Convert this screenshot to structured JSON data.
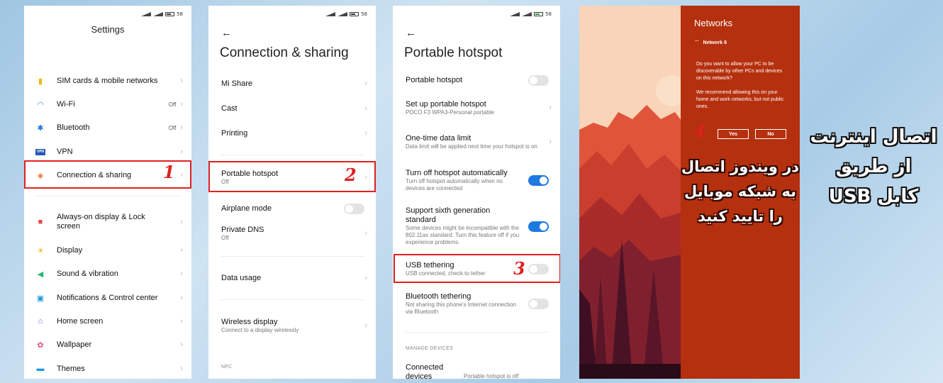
{
  "status": {
    "battery": "58"
  },
  "phone1": {
    "title": "Settings",
    "items": [
      {
        "icon": "sim-card-icon",
        "glyph": "▮",
        "color": "#f2b400",
        "label": "SIM cards & mobile networks",
        "value": ""
      },
      {
        "icon": "wifi-icon",
        "glyph": "◠",
        "color": "#1f9bde",
        "label": "Wi-Fi",
        "value": "Off"
      },
      {
        "icon": "bluetooth-icon",
        "glyph": "✱",
        "color": "#1f7ae0",
        "label": "Bluetooth",
        "value": "Off"
      },
      {
        "icon": "vpn-icon",
        "glyph": "VPN",
        "color": "#2356b5",
        "label": "VPN",
        "value": ""
      },
      {
        "icon": "connection-sharing-icon",
        "glyph": "◈",
        "color": "#f06a2a",
        "label": "Connection & sharing",
        "value": ""
      },
      {
        "icon": "lock-icon",
        "glyph": "■",
        "color": "#e84a4a",
        "label": "Always-on display & Lock screen",
        "value": ""
      },
      {
        "icon": "display-icon",
        "glyph": "☀",
        "color": "#f2b400",
        "label": "Display",
        "value": ""
      },
      {
        "icon": "sound-icon",
        "glyph": "◀",
        "color": "#2ab86b",
        "label": "Sound & vibration",
        "value": ""
      },
      {
        "icon": "notifications-icon",
        "glyph": "▣",
        "color": "#1f9bde",
        "label": "Notifications & Control center",
        "value": ""
      },
      {
        "icon": "home-screen-icon",
        "glyph": "⌂",
        "color": "#6a5ae0",
        "label": "Home screen",
        "value": ""
      },
      {
        "icon": "wallpaper-icon",
        "glyph": "✿",
        "color": "#e84a8a",
        "label": "Wallpaper",
        "value": ""
      },
      {
        "icon": "themes-icon",
        "glyph": "▬",
        "color": "#1f9bde",
        "label": "Themes",
        "value": ""
      }
    ],
    "step": "1"
  },
  "phone2": {
    "title": "Connection & sharing",
    "mi_share": "Mi Share",
    "cast": "Cast",
    "printing": "Printing",
    "hotspot": "Portable hotspot",
    "hotspot_sub": "Off",
    "airplane": "Airplane mode",
    "dns": "Private DNS",
    "dns_sub": "Off",
    "data_usage": "Data usage",
    "wireless": "Wireless display",
    "wireless_sub": "Connect to a display wirelessly",
    "nfc": "NFC",
    "step": "2"
  },
  "phone3": {
    "title": "Portable hotspot",
    "hotspot": "Portable hotspot",
    "setup": "Set up portable hotspot",
    "setup_sub": "POCO F3 WPA3-Personal portable",
    "limit": "One-time data limit",
    "limit_sub": "Data limit will be applied next time your hotspot is on",
    "turnoff": "Turn off hotspot automatically",
    "turnoff_sub": "Turn off hotspot automatically when no devices are connected",
    "sixth": "Support sixth generation standard",
    "sixth_sub": "Some devices might be incompatible with the 802.11ax standard. Turn this feature off if you experience problems.",
    "usb": "USB tethering",
    "usb_sub": "USB connected, check to tether",
    "bt": "Bluetooth tethering",
    "bt_sub": "Not sharing this phone's Internet connection via Bluetooth",
    "manage": "MANAGE DEVICES",
    "connected": "Connected devices",
    "connected_sub": "Portable hotspot is off",
    "step": "3"
  },
  "windows": {
    "title": "Networks",
    "network": "Network 6",
    "question": "Do you want to allow your PC to be discoverable by other PCs and devices on this network?",
    "recommend": "We recommend allowing this on your home and work networks, but not public ones.",
    "yes": "Yes",
    "no": "No",
    "step": "4",
    "persian": [
      "در ویندوز اتصال",
      "به شبکه موبایل",
      "را تایید کنید"
    ]
  },
  "headline": [
    "اتصال اینترنت",
    "از طریق",
    "کابل USB"
  ]
}
